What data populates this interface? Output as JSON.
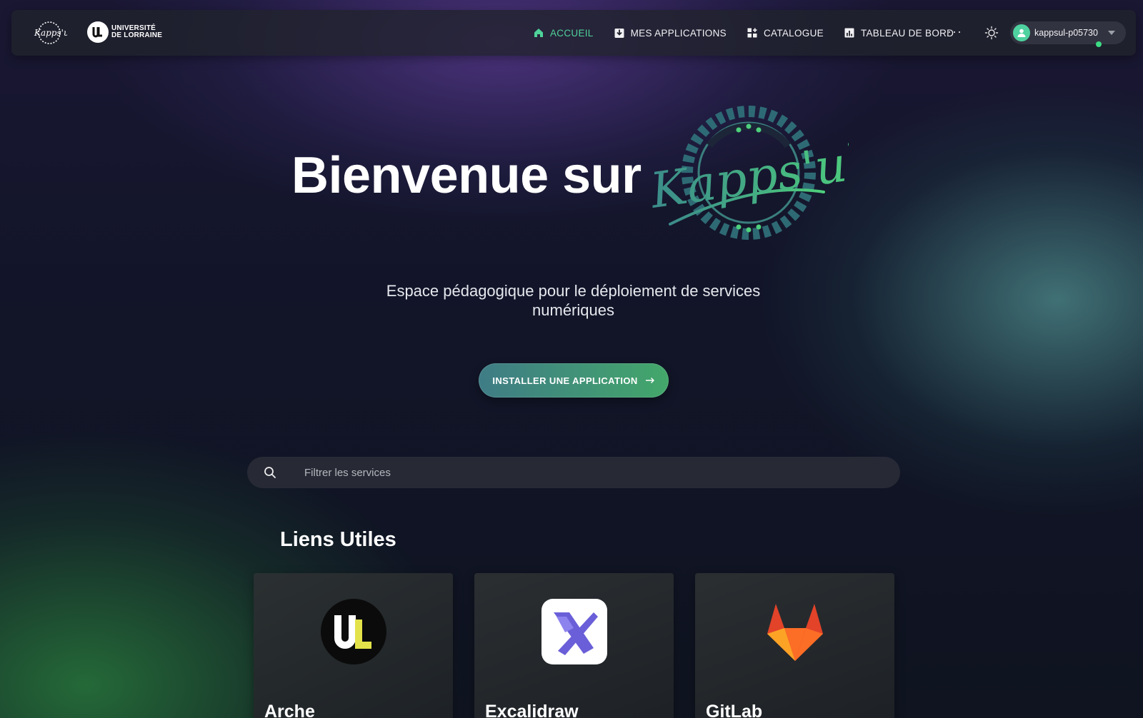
{
  "header": {
    "brand_logo": "kappsul-small-logo",
    "university": {
      "line1": "UNIVERSITÉ",
      "line2": "DE LORRAINE"
    },
    "nav": [
      {
        "label": "ACCUEIL",
        "icon": "home-icon",
        "active": true
      },
      {
        "label": "MES APPLICATIONS",
        "icon": "download-box-icon",
        "active": false
      },
      {
        "label": "CATALOGUE",
        "icon": "apps-grid-icon",
        "active": false
      },
      {
        "label": "TABLEAU DE BORD",
        "icon": "bar-chart-icon",
        "active": false
      }
    ],
    "more_label": "···",
    "theme_icon": "sun-icon",
    "user": {
      "name": "kappsul-p05730",
      "status": "online"
    }
  },
  "hero": {
    "title": "Bienvenue sur",
    "logo_text": "Kapps'ul",
    "subtitle": "Espace pédagogique pour le déploiement de services numériques",
    "cta_label": "INSTALLER UNE APPLICATION",
    "cta_icon": "arrow-right-icon"
  },
  "search": {
    "placeholder": "Filtrer les services",
    "value": ""
  },
  "links": {
    "title": "Liens Utiles",
    "cards": [
      {
        "name": "Arche",
        "icon": "arche-logo"
      },
      {
        "name": "Excalidraw",
        "icon": "excalidraw-logo"
      },
      {
        "name": "GitLab",
        "icon": "gitlab-logo"
      }
    ]
  },
  "colors": {
    "accent": "#4fd29a",
    "cta_start": "#3f7c86",
    "cta_end": "#43a76a",
    "navbar": "#20222c"
  }
}
